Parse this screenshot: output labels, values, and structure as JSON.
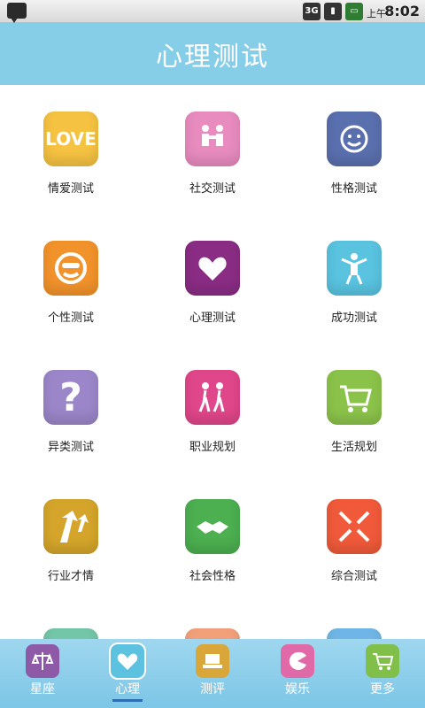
{
  "status": {
    "ampm": "上午",
    "time": "8:02",
    "network": "3G"
  },
  "header": {
    "title": "心理测试"
  },
  "grid": {
    "items": [
      {
        "label": "情爱测试",
        "icon": "love-icon",
        "color": "#f5c242",
        "icon_text": "LOVE"
      },
      {
        "label": "社交测试",
        "icon": "social-people-icon",
        "color": "#e88bbf",
        "icon_text": ""
      },
      {
        "label": "性格测试",
        "icon": "smiley-headphones-icon",
        "color": "#5a6fae",
        "icon_text": ""
      },
      {
        "label": "个性测试",
        "icon": "cool-face-icon",
        "color": "#f2922a",
        "icon_text": ""
      },
      {
        "label": "心理测试",
        "icon": "heart-hands-icon",
        "color": "#8a2c84",
        "icon_text": ""
      },
      {
        "label": "成功测试",
        "icon": "success-person-icon",
        "color": "#59c3e0",
        "icon_text": ""
      },
      {
        "label": "异类测试",
        "icon": "question-mark-icon",
        "color": "#9b86c9",
        "icon_text": "?"
      },
      {
        "label": "职业规划",
        "icon": "hikers-icon",
        "color": "#e0468a",
        "icon_text": ""
      },
      {
        "label": "生活规划",
        "icon": "shopping-cart-icon",
        "color": "#8bc34a",
        "icon_text": ""
      },
      {
        "label": "行业才情",
        "icon": "arrows-up-icon",
        "color": "#d4a52a",
        "icon_text": ""
      },
      {
        "label": "社会性格",
        "icon": "handshake-icon",
        "color": "#4caf50",
        "icon_text": ""
      },
      {
        "label": "综合测试",
        "icon": "arrows-in-icon",
        "color": "#f05a3a",
        "icon_text": ""
      }
    ]
  },
  "tabbar": {
    "tabs": [
      {
        "label": "星座",
        "icon": "scales-icon",
        "color": "#8e5aa8",
        "active": false
      },
      {
        "label": "心理",
        "icon": "heart-icon",
        "color": "#5cc2e0",
        "active": true
      },
      {
        "label": "测评",
        "icon": "laptop-icon",
        "color": "#d9a63a",
        "active": false
      },
      {
        "label": "娱乐",
        "icon": "pacman-icon",
        "color": "#e06aa8",
        "active": false
      },
      {
        "label": "更多",
        "icon": "cart-icon",
        "color": "#7fbf4a",
        "active": false
      }
    ]
  }
}
